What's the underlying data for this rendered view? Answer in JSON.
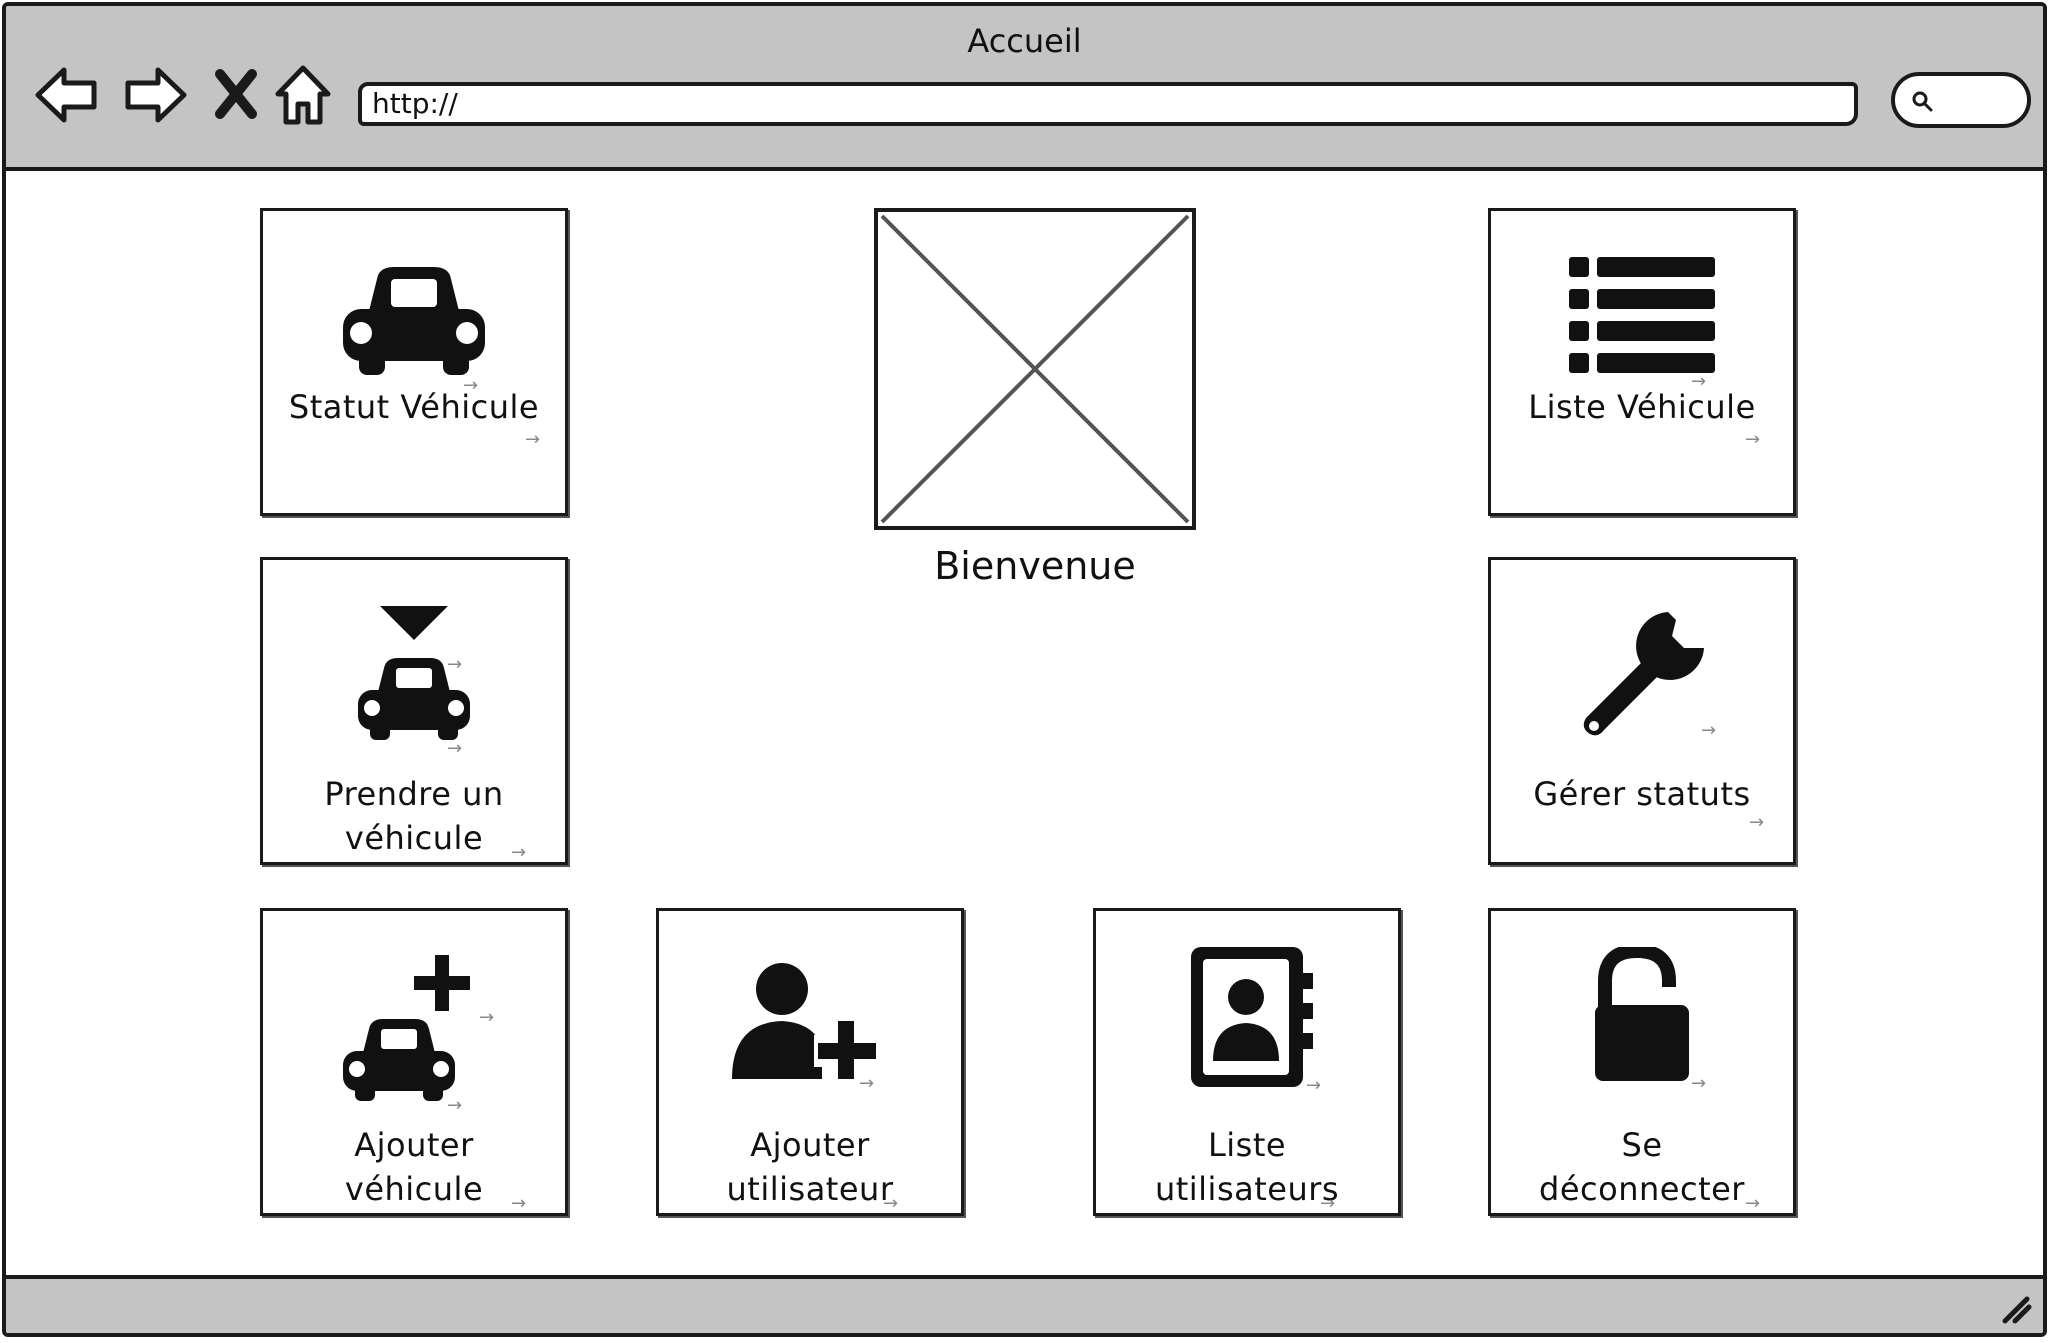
{
  "window": {
    "title": "Accueil",
    "url": "http://"
  },
  "icons": {
    "back": "back-arrow-icon",
    "forward": "forward-arrow-icon",
    "stop": "close-icon",
    "home": "home-icon",
    "search": "search-icon"
  },
  "welcome": {
    "image": "image-placeholder",
    "text": "Bienvenue"
  },
  "tiles": {
    "statut_vehicule": {
      "label": "Statut Véhicule",
      "icon": "car-icon"
    },
    "liste_vehicule": {
      "label": "Liste Véhicule",
      "icon": "list-icon"
    },
    "prendre_vehicule": {
      "line1": "Prendre un",
      "line2": "véhicule",
      "icon": "car-with-down-arrow-icon"
    },
    "gerer_statuts": {
      "label": "Gérer statuts",
      "icon": "wrench-icon"
    },
    "ajouter_vehicule": {
      "line1": "Ajouter",
      "line2": "véhicule",
      "icon": "car-add-icon"
    },
    "ajouter_utilisateur": {
      "line1": "Ajouter",
      "line2": "utilisateur",
      "icon": "user-add-icon"
    },
    "liste_utilisateurs": {
      "line1": "Liste",
      "line2": "utilisateurs",
      "icon": "address-book-icon"
    },
    "se_deconnecter": {
      "line1": "Se",
      "line2": "déconnecter",
      "icon": "unlock-icon"
    }
  },
  "colors": {
    "chrome": "#c4c4c4",
    "ink": "#1a1a1a",
    "background": "#ffffff"
  }
}
